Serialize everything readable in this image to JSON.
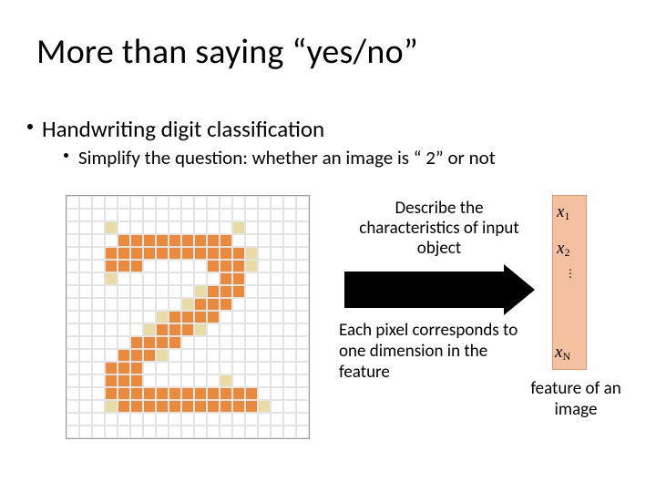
{
  "title": "More than saying “yes/no”",
  "bullets": {
    "l1": "Handwriting digit classification",
    "l2": "Simplify the question: whether an image is “ 2” or not"
  },
  "desc1": "Describe the characteristics of input object",
  "desc2": "Each pixel corresponds to one dimension in the feature",
  "feature": {
    "x1_var": "x",
    "x1_sub": "1",
    "x2_var": "x",
    "x2_sub": "2",
    "dots": "⋮",
    "xn_var": "x",
    "xn_sub": "N",
    "caption": "feature of an image"
  },
  "pixel_grid": {
    "rows": 19,
    "cols": 19,
    "legend": {
      ".": "blank",
      "y": "light-yellow",
      "o": "orange"
    },
    "map": [
      "...................",
      "...................",
      "...y.........y.....",
      "....ooooooooo......",
      "...oooooooooooy....",
      "...ooo.....oooy....",
      "...y........oo.....",
      "..........yooo.....",
      ".........yooo......",
      ".......yoooo.......",
      "......yoooy........",
      ".....oooo..........",
      "....oooy...........",
      "...ooo.............",
      "...ooo......y......",
      "...oooooooooooo....",
      "...yoooooooooooy...",
      "...................",
      "..................."
    ]
  }
}
